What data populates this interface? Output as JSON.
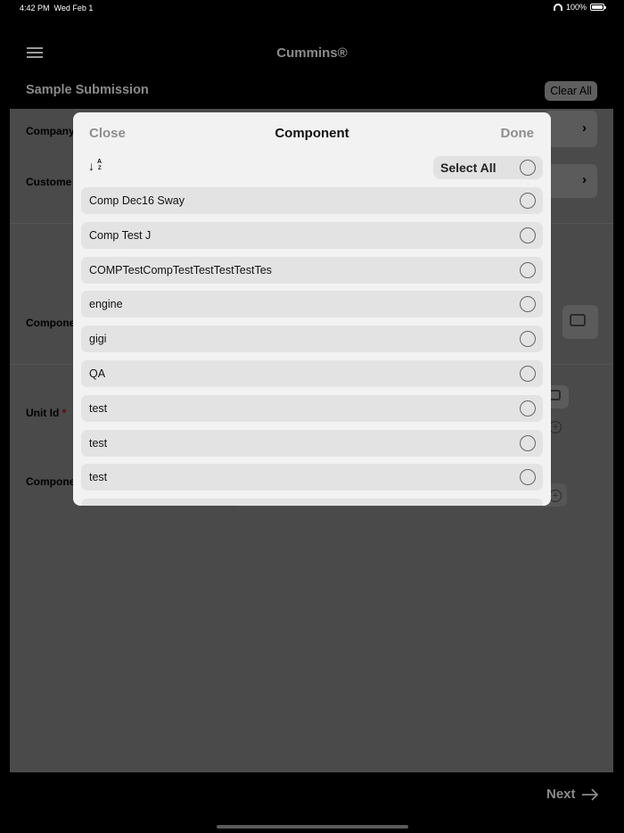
{
  "status_bar": {
    "time": "4:42 PM",
    "date": "Wed Feb 1",
    "battery": "100%"
  },
  "nav": {
    "title": "Cummins®"
  },
  "page": {
    "title": "Sample Submission",
    "clear_all_label": "Clear All"
  },
  "form": {
    "company_label": "Company",
    "customer_label": "Custome",
    "component_label": "Compone",
    "unit_id_label": "Unit Id",
    "required_mark": "*",
    "component2_label": "Compone"
  },
  "modal": {
    "close_label": "Close",
    "title": "Component",
    "done_label": "Done",
    "select_all_label": "Select All",
    "items": [
      {
        "label": "Comp Dec16 Sway"
      },
      {
        "label": "Comp Test J"
      },
      {
        "label": "COMPTestCompTestTestTestTestTes"
      },
      {
        "label": "engine"
      },
      {
        "label": "gigi"
      },
      {
        "label": "QA"
      },
      {
        "label": "test"
      },
      {
        "label": "test"
      },
      {
        "label": "test"
      }
    ]
  },
  "footer": {
    "next_label": "Next"
  },
  "icons": {
    "menu": "hamburger-icon",
    "sort": "sort-alphabetical-icon",
    "next": "arrow-right-icon",
    "scan": "barcode-scan-icon",
    "add": "plus-circle-icon"
  }
}
